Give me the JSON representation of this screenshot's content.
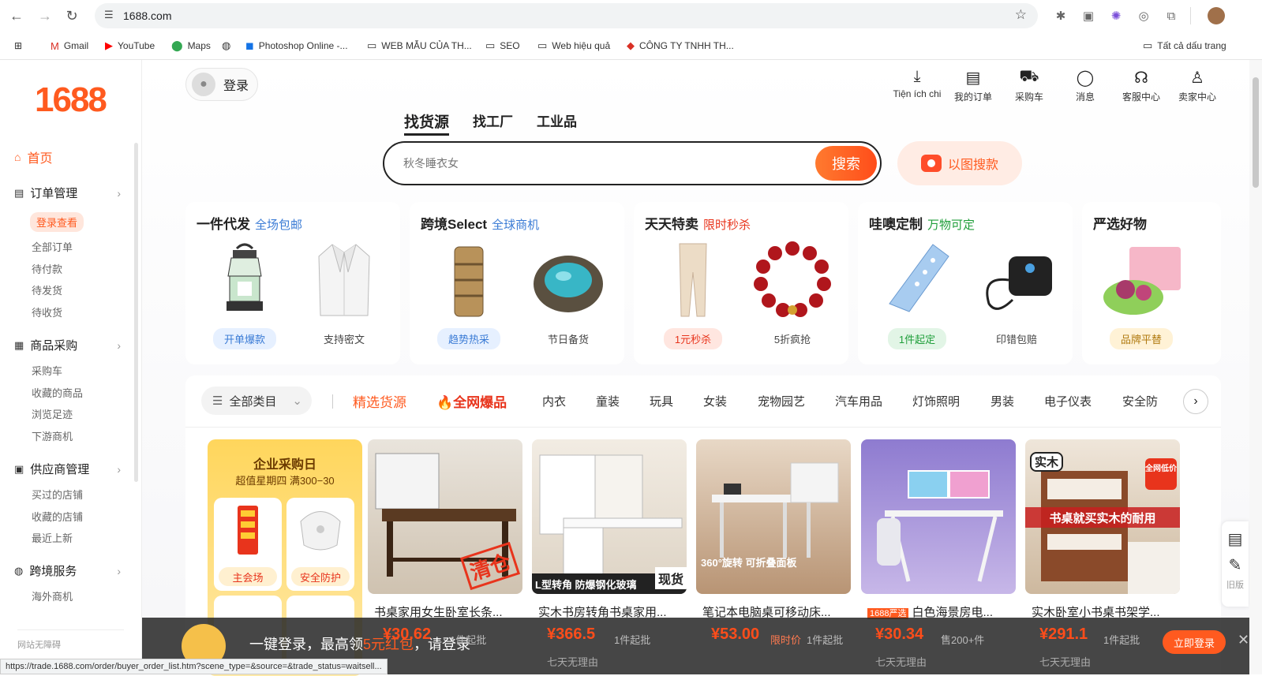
{
  "browser": {
    "url": "1688.com",
    "status_url": "https://trade.1688.com/order/buyer_order_list.htm?scene_type=&source=&trade_status=waitsell...",
    "bookmarks": [
      {
        "label": "Gmail",
        "icon": "gmail-icon"
      },
      {
        "label": "YouTube",
        "icon": "youtube-icon"
      },
      {
        "label": "Maps",
        "icon": "maps-icon"
      },
      {
        "label": "",
        "icon": "globe-icon"
      },
      {
        "label": "Photoshop Online -...",
        "icon": "photoshop-icon"
      },
      {
        "label": "WEB MẪU CỦA TH...",
        "icon": "folder-icon"
      },
      {
        "label": "SEO",
        "icon": "folder-icon"
      },
      {
        "label": "Web hiệu quả",
        "icon": "folder-icon"
      },
      {
        "label": "CÔNG TY TNHH TH...",
        "icon": "site-icon"
      }
    ],
    "all_bookmarks": "Tất cả dấu trang"
  },
  "sidebar": {
    "logo": "1688",
    "home": "首页",
    "sections": [
      {
        "label": "订单管理",
        "items": [
          "全部订单",
          "待付款",
          "待发货",
          "待收货"
        ],
        "pill": "登录查看"
      },
      {
        "label": "商品采购",
        "items": [
          "采购车",
          "收藏的商品",
          "浏览足迹",
          "下游商机"
        ]
      },
      {
        "label": "供应商管理",
        "items": [
          "买过的店铺",
          "收藏的店铺",
          "最近上新"
        ]
      },
      {
        "label": "跨境服务",
        "items": [
          "海外商机"
        ]
      }
    ],
    "footer": "网站无障碍"
  },
  "header": {
    "login": "登录",
    "icons": [
      {
        "label": "Tiện ích chi",
        "icon": "download-icon"
      },
      {
        "label": "我的订单",
        "icon": "clipboard-icon"
      },
      {
        "label": "采购车",
        "icon": "cart-icon"
      },
      {
        "label": "消息",
        "icon": "message-icon"
      },
      {
        "label": "客服中心",
        "icon": "headset-icon"
      },
      {
        "label": "卖家中心",
        "icon": "user-icon"
      }
    ],
    "tabs": [
      "找货源",
      "找工厂",
      "工业品"
    ],
    "search_placeholder": "秋冬睡衣女",
    "search_button": "搜索",
    "image_search": "以图搜款"
  },
  "cards": [
    {
      "title": "一件代发",
      "sub": "全场包邮",
      "sub_color": "#3a7bd5",
      "labels": [
        "开单爆款",
        "支持密文"
      ]
    },
    {
      "title": "跨境Select",
      "sub": "全球商机",
      "sub_color": "#3a7bd5",
      "labels": [
        "趋势热采",
        "节日备货"
      ]
    },
    {
      "title": "天天特卖",
      "sub": "限时秒杀",
      "sub_color": "#e8341c",
      "labels": [
        "1元秒杀",
        "5折疯抢"
      ]
    },
    {
      "title": "哇噢定制",
      "sub": "万物可定",
      "sub_color": "#1f9e3a",
      "labels": [
        "1件起定",
        "印错包赔"
      ]
    },
    {
      "title": "严选好物",
      "sub": "",
      "sub_color": "#222",
      "labels": [
        "品牌平替"
      ]
    }
  ],
  "categories": {
    "all": "全部类目",
    "featured": "精选货源",
    "hot": "全网爆品",
    "items": [
      "内衣",
      "童装",
      "玩具",
      "女装",
      "宠物园艺",
      "汽车用品",
      "灯饰照明",
      "男装",
      "电子仪表",
      "安全防"
    ]
  },
  "promo": {
    "title": "企业采购日",
    "subtitle": "超值星期四 满300−30",
    "buttons": [
      "主会场",
      "安全防护"
    ]
  },
  "products": [
    {
      "title": "书桌家用女生卧室长条...",
      "badge": "清仓",
      "price": "¥30.62",
      "meta": "1件起批",
      "sub": ""
    },
    {
      "title": "实木书房转角书桌家用...",
      "badge": "现货",
      "overlay": "L型转角 防爆钢化玻璃",
      "price": "¥366.5",
      "meta": "1件起批",
      "sub": "七天无理由"
    },
    {
      "title": "笔记本电脑桌可移动床...",
      "overlay": "360°旋转 可折叠面板",
      "price": "¥53.00",
      "meta_red": "限时价",
      "meta": "1件起批",
      "sub": ""
    },
    {
      "title": "白色海景房电...",
      "tag": "1688严选",
      "price": "¥30.34",
      "meta": "售200+件",
      "sub": "七天无理由"
    },
    {
      "title": "实木卧室小书桌书架学...",
      "brand": "实木",
      "overlay": "书桌就买实木的耐用",
      "corner": "全网低价",
      "price": "¥291.1",
      "meta": "1件起批",
      "sub": "七天无理由"
    }
  ],
  "float_tools": {
    "old_version": "旧版"
  },
  "login_banner": {
    "text_pre": "一键登录，最高领",
    "text_red": "5元红包",
    "text_post": "，请登录",
    "button": "立即登录"
  }
}
